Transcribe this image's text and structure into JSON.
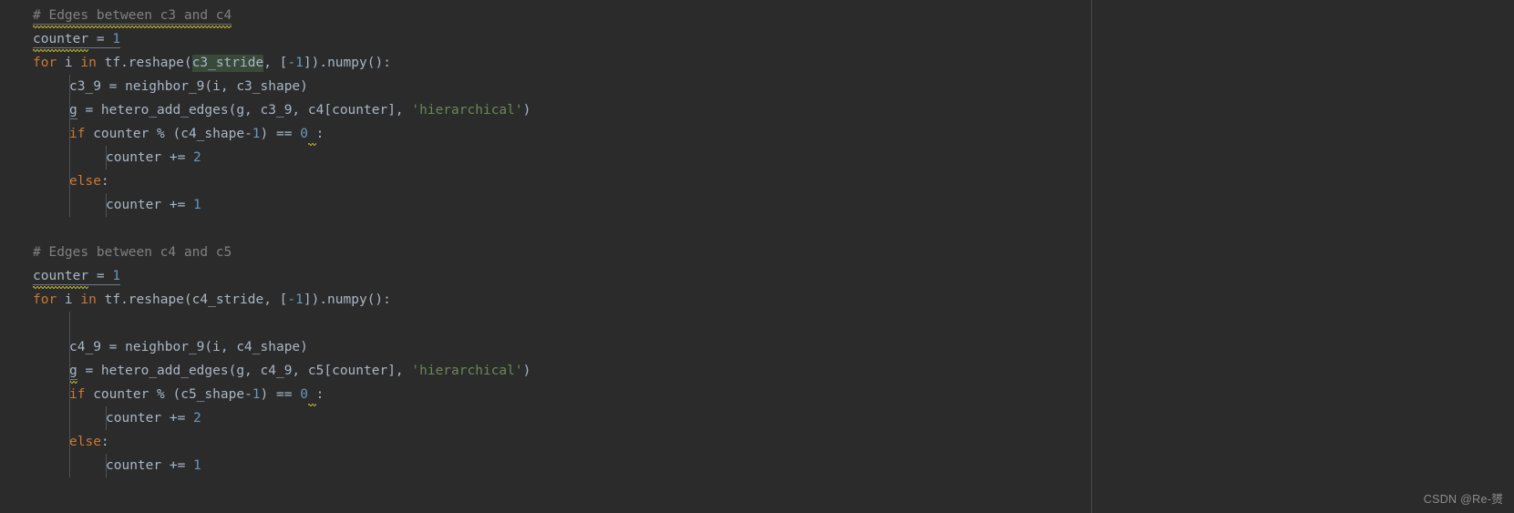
{
  "editor": {
    "language": "Python",
    "theme": "darcula-dark",
    "background_color": "#2b2b2b",
    "default_text_color": "#a9b7c6",
    "keyword_color": "#cc7832",
    "number_color": "#6897bb",
    "string_color": "#6a8759",
    "comment_color": "#808080",
    "occurrence_highlight_color": "#3a4a3a",
    "warning_squiggle_color": "#bbb529",
    "indent_guide_color": "#4f5355",
    "pane_divider_color": "#4a4a4a"
  },
  "code": {
    "lines": [
      {
        "id": "l1",
        "indent": 0,
        "text": "# Edges between c3 and c4",
        "tokens": [
          {
            "t": "# Edges between c3 and c4",
            "c": "cmt",
            "underline": "solid",
            "squiggle": true
          }
        ]
      },
      {
        "id": "l2",
        "indent": 0,
        "text": "counter = 1",
        "tokens": [
          {
            "t": "counter",
            "c": "def",
            "underline": "solid",
            "squiggle": true
          },
          {
            "t": " = ",
            "c": "def",
            "underline": "solid"
          },
          {
            "t": "1",
            "c": "num",
            "underline": "solid"
          }
        ]
      },
      {
        "id": "l3",
        "indent": 0,
        "text": "for i in tf.reshape(c3_stride, [-1]).numpy():",
        "tokens": [
          {
            "t": "for",
            "c": "kw"
          },
          {
            "t": " i ",
            "c": "def"
          },
          {
            "t": "in",
            "c": "kw"
          },
          {
            "t": " tf.reshape(",
            "c": "def"
          },
          {
            "t": "c3_stride",
            "c": "def",
            "highlight": true
          },
          {
            "t": ", [",
            "c": "def"
          },
          {
            "t": "-1",
            "c": "num"
          },
          {
            "t": "]).numpy():",
            "c": "def"
          }
        ]
      },
      {
        "id": "l4",
        "indent": 1,
        "text": "c3_9 = neighbor_9(i, c3_shape)",
        "tokens": [
          {
            "t": "c3_9 = neighbor_9(i, c3_shape)",
            "c": "def"
          }
        ]
      },
      {
        "id": "l5",
        "indent": 1,
        "text": "g = hetero_add_edges(g, c3_9, c4[counter], 'hierarchical')",
        "tokens": [
          {
            "t": "g",
            "c": "def",
            "underline": "solid"
          },
          {
            "t": " = hetero_add_edges(g, c3_9, c4[counter], ",
            "c": "def"
          },
          {
            "t": "'hierarchical'",
            "c": "str"
          },
          {
            "t": ")",
            "c": "def"
          }
        ]
      },
      {
        "id": "l6",
        "indent": 1,
        "text": "if counter % (c4_shape-1) == 0 :",
        "tokens": [
          {
            "t": "if",
            "c": "kw"
          },
          {
            "t": " counter % (c4_shape-",
            "c": "def"
          },
          {
            "t": "1",
            "c": "num"
          },
          {
            "t": ") == ",
            "c": "def"
          },
          {
            "t": "0",
            "c": "num"
          },
          {
            "t": " ",
            "c": "def",
            "squiggle": true
          },
          {
            "t": ":",
            "c": "def"
          }
        ]
      },
      {
        "id": "l7",
        "indent": 2,
        "text": "counter += 2",
        "tokens": [
          {
            "t": "counter += ",
            "c": "def"
          },
          {
            "t": "2",
            "c": "num"
          }
        ]
      },
      {
        "id": "l8",
        "indent": 1,
        "text": "else:",
        "tokens": [
          {
            "t": "else",
            "c": "kw"
          },
          {
            "t": ":",
            "c": "def"
          }
        ]
      },
      {
        "id": "l9",
        "indent": 2,
        "text": "counter += 1",
        "tokens": [
          {
            "t": "counter += ",
            "c": "def"
          },
          {
            "t": "1",
            "c": "num"
          }
        ]
      },
      {
        "id": "l10",
        "indent": 0,
        "text": "",
        "tokens": []
      },
      {
        "id": "l11",
        "indent": 0,
        "text": "# Edges between c4 and c5",
        "tokens": [
          {
            "t": "# Edges between c4 and c5",
            "c": "cmt"
          }
        ]
      },
      {
        "id": "l12",
        "indent": 0,
        "text": "counter = 1",
        "tokens": [
          {
            "t": "counter",
            "c": "def",
            "underline": "solid",
            "squiggle": true
          },
          {
            "t": " = ",
            "c": "def",
            "underline": "solid"
          },
          {
            "t": "1",
            "c": "num",
            "underline": "solid"
          }
        ]
      },
      {
        "id": "l13",
        "indent": 0,
        "text": "for i in tf.reshape(c4_stride, [-1]).numpy():",
        "tokens": [
          {
            "t": "for",
            "c": "kw"
          },
          {
            "t": " i ",
            "c": "def"
          },
          {
            "t": "in",
            "c": "kw"
          },
          {
            "t": " tf.reshape(c4_stride, [",
            "c": "def"
          },
          {
            "t": "-1",
            "c": "num"
          },
          {
            "t": "]).numpy():",
            "c": "def"
          }
        ]
      },
      {
        "id": "l14",
        "indent": 1,
        "text": "",
        "tokens": []
      },
      {
        "id": "l15",
        "indent": 1,
        "text": "c4_9 = neighbor_9(i, c4_shape)",
        "tokens": [
          {
            "t": "c4_9 = neighbor_9(i, c4_shape)",
            "c": "def"
          }
        ]
      },
      {
        "id": "l16",
        "indent": 1,
        "text": "g = hetero_add_edges(g, c4_9, c5[counter], 'hierarchical')",
        "tokens": [
          {
            "t": "g",
            "c": "def",
            "underline": "solid",
            "squiggle": true
          },
          {
            "t": " = hetero_add_edges(g, c4_9, c5[counter], ",
            "c": "def"
          },
          {
            "t": "'hierarchical'",
            "c": "str"
          },
          {
            "t": ")",
            "c": "def"
          }
        ]
      },
      {
        "id": "l17",
        "indent": 1,
        "text": "if counter % (c5_shape-1) == 0 :",
        "tokens": [
          {
            "t": "if",
            "c": "kw"
          },
          {
            "t": " counter % (c5_shape-",
            "c": "def"
          },
          {
            "t": "1",
            "c": "num"
          },
          {
            "t": ") == ",
            "c": "def"
          },
          {
            "t": "0",
            "c": "num"
          },
          {
            "t": " ",
            "c": "def",
            "squiggle": true
          },
          {
            "t": ":",
            "c": "def"
          }
        ]
      },
      {
        "id": "l18",
        "indent": 2,
        "text": "counter += 2",
        "tokens": [
          {
            "t": "counter += ",
            "c": "def"
          },
          {
            "t": "2",
            "c": "num"
          }
        ]
      },
      {
        "id": "l19",
        "indent": 1,
        "text": "else:",
        "tokens": [
          {
            "t": "else",
            "c": "kw"
          },
          {
            "t": ":",
            "c": "def"
          }
        ]
      },
      {
        "id": "l20",
        "indent": 2,
        "text": "counter += 1",
        "tokens": [
          {
            "t": "counter += ",
            "c": "def"
          },
          {
            "t": "1",
            "c": "num"
          }
        ]
      }
    ]
  },
  "watermark": {
    "text": "CSDN @Re-赟"
  }
}
